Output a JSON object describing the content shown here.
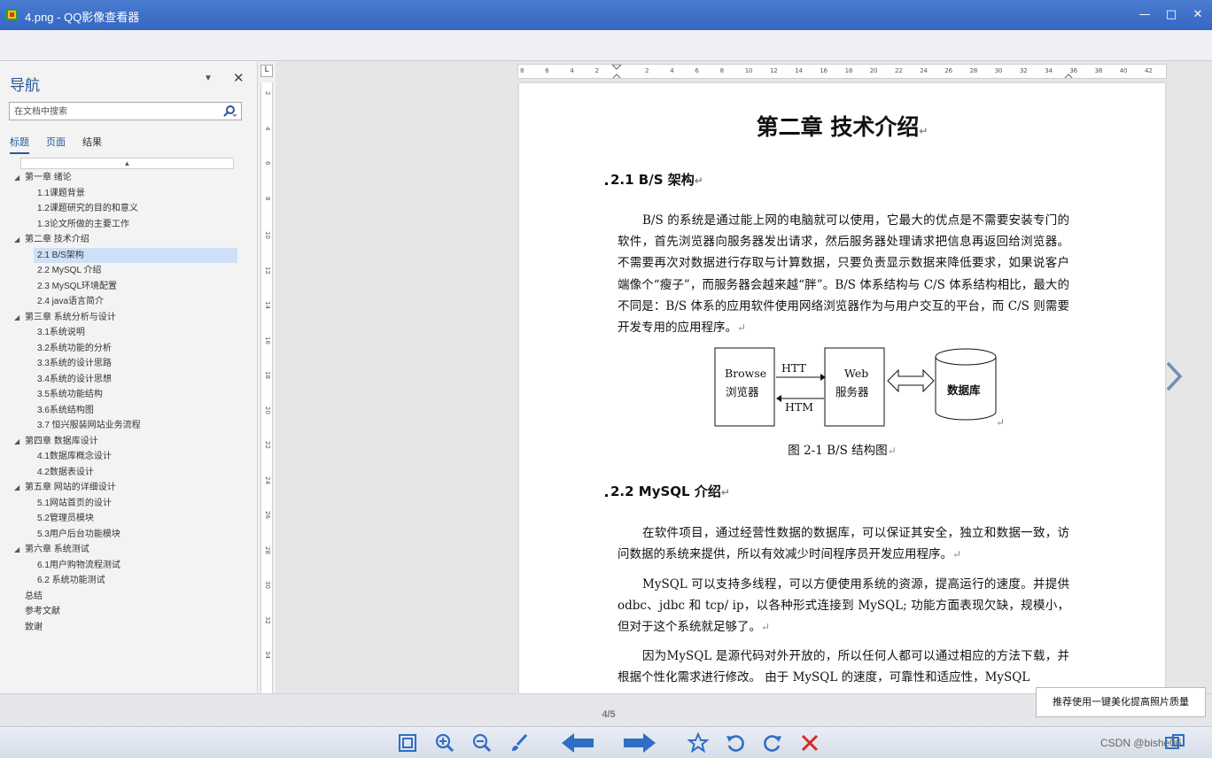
{
  "window": {
    "title": "4.png - QQ影像查看器",
    "minimize_label": "—",
    "maximize_label": "□",
    "close_label": "✕"
  },
  "nav": {
    "title": "导航",
    "dropdown_label": "▼",
    "close_label": "✕",
    "search": {
      "placeholder": "在文档中搜索",
      "value": ""
    },
    "tabs": [
      {
        "label": "标题",
        "active": true
      },
      {
        "label": "页面",
        "active": false
      },
      {
        "label": "结果",
        "active": false
      }
    ],
    "collapse_label": "▲",
    "tree": [
      {
        "label": "第一章 绪论",
        "level": 1,
        "expanded": true
      },
      {
        "label": "1.1课题背景",
        "level": 2
      },
      {
        "label": "1.2课题研究的目的和意义",
        "level": 2
      },
      {
        "label": "1.3论文所做的主要工作",
        "level": 2
      },
      {
        "label": "第二章 技术介绍",
        "level": 1,
        "expanded": true
      },
      {
        "label": "2.1 B/S架构",
        "level": 2,
        "selected": true
      },
      {
        "label": "2.2 MySQL 介绍",
        "level": 2
      },
      {
        "label": "2.3 MySQL环境配置",
        "level": 2
      },
      {
        "label": "2.4 java语言简介",
        "level": 2
      },
      {
        "label": "第三章 系统分析与设计",
        "level": 1,
        "expanded": true
      },
      {
        "label": "3.1系统说明",
        "level": 2
      },
      {
        "label": "3.2系统功能的分析",
        "level": 2
      },
      {
        "label": "3.3系统的设计思路",
        "level": 2
      },
      {
        "label": "3.4系统的设计思想",
        "level": 2
      },
      {
        "label": "3.5系统功能结构",
        "level": 2
      },
      {
        "label": "3.6系统结构图",
        "level": 2
      },
      {
        "label": "3.7 恒兴服装网站业务流程",
        "level": 2
      },
      {
        "label": "第四章 数据库设计",
        "level": 1,
        "expanded": true
      },
      {
        "label": "4.1数据库概念设计",
        "level": 2
      },
      {
        "label": "4.2数据表设计",
        "level": 2
      },
      {
        "label": "第五章 网站的详细设计",
        "level": 1,
        "expanded": true
      },
      {
        "label": "5.1网站首页的设计",
        "level": 2
      },
      {
        "label": "5.2管理员模块",
        "level": 2
      },
      {
        "label": "5.3用户后台功能模块",
        "level": 2
      },
      {
        "label": "第六章 系统测试",
        "level": 1,
        "expanded": true
      },
      {
        "label": "6.1用户购物流程测试",
        "level": 2
      },
      {
        "label": "6.2 系统功能测试",
        "level": 2
      },
      {
        "label": "总结",
        "level": 0
      },
      {
        "label": "参考文献",
        "level": 0
      },
      {
        "label": "致谢",
        "level": 0
      }
    ]
  },
  "ruler": {
    "corner_label": "L",
    "h_ticks": [
      "8",
      "6",
      "4",
      "2",
      "",
      "2",
      "4",
      "6",
      "8",
      "10",
      "12",
      "14",
      "16",
      "18",
      "20",
      "22",
      "24",
      "26",
      "28",
      "30",
      "32",
      "34",
      "36",
      "38",
      "40",
      "42"
    ],
    "v_ticks": [
      "2",
      "4",
      "6",
      "8",
      "10",
      "12",
      "14",
      "16",
      "18",
      "20",
      "22",
      "24",
      "26",
      "28",
      "30",
      "32",
      "34"
    ]
  },
  "document": {
    "chapter_title": "第二章  技术介绍",
    "para_mark": "↵",
    "section1_heading": "2.1 B/S 架构",
    "section1_para": "B/S 的系统是通过能上网的电脑就可以使用，它最大的优点是不需要安装专门的软件，首先浏览器向服务器发出请求，然后服务器处理请求把信息再返回给浏览器。不需要再次对数据进行存取与计算数据，只要负责显示数据来降低要求，如果说客户端像个“瘦子”，而服务器会越来越“胖”。B/S 体系结构与 C/S 体系结构相比，最大的不同是：B/S 体系的应用软件使用网络浏览器作为与用户交互的平台，而 C/S 则需要开发专用的应用程序。",
    "diagram": {
      "browser_en": "Browse",
      "browser_cn": "浏览器",
      "request": "HTT",
      "response": "HTM",
      "server_en": "Web",
      "server_cn": "服务器",
      "db": "数据库"
    },
    "figure_caption": "图 2-1 B/S 结构图",
    "section2_heading": "2.2 MySQL  介绍",
    "section2_para1": "在软件项目，通过经营性数据的数据库，可以保证其安全，独立和数据一致，访问数据的系统来提供，所以有效减少时间程序员开发应用程序。",
    "section2_para2": "MySQL 可以支持多线程，可以方便使用系统的资源，提高运行的速度。并提供 odbc、jdbc 和 tcp/ ip，以各种形式连接到 MySQL; 功能方面表现欠缺，规模小，但对于这个系统就足够了。",
    "section2_para3": "因为MySQL 是源代码对外开放的，所以任何人都可以通过相应的方法下载，并根据个性化需求进行修改。 由于 MySQL 的速度，可靠性和适应性，MySQL"
  },
  "viewer": {
    "page_indicator": "4/5",
    "tooltip": "推荐使用一键美化提高照片质量",
    "watermark": "CSDN @bishe06"
  },
  "colors": {
    "titlebar": "#3d6fc8",
    "nav_accent": "#2b579a",
    "arrow_blue": "#2f6ec2",
    "delete_red": "#d42a2a"
  }
}
